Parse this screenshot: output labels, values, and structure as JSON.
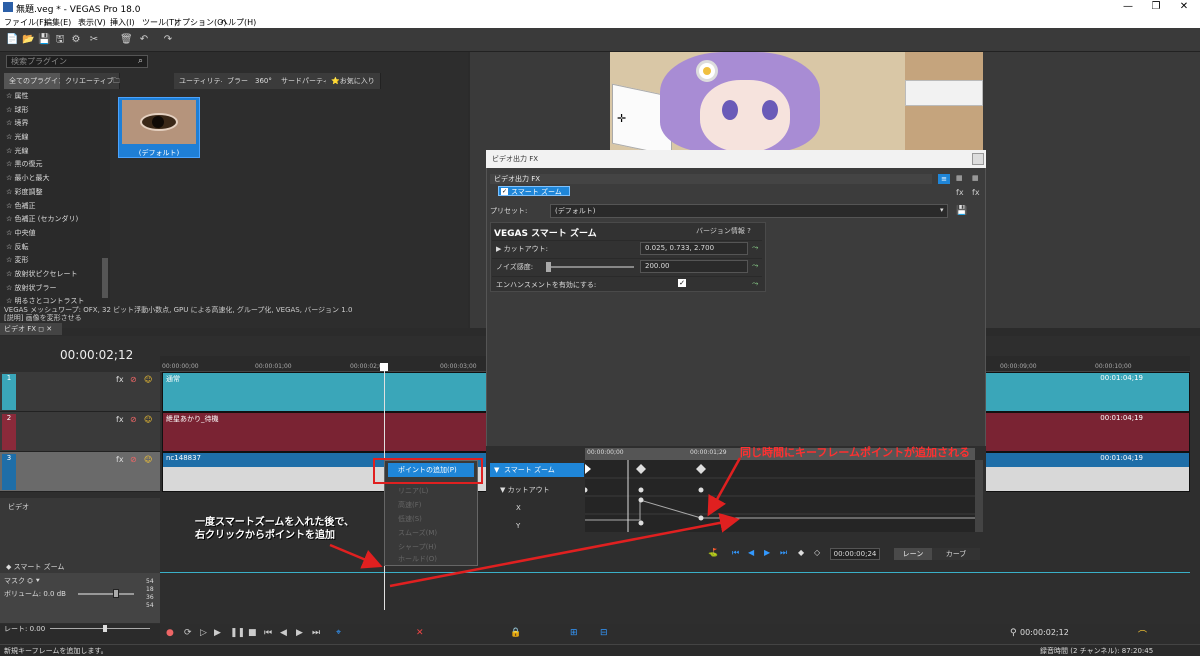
{
  "window": {
    "title": "無題.veg * - VEGAS Pro 18.0",
    "controls": [
      "—",
      "❐",
      "✕"
    ]
  },
  "menu": [
    "ファイル(F)",
    "編集(E)",
    "表示(V)",
    "挿入(I)",
    "ツール(T)",
    "オプション(O)",
    "ヘルプ(H)"
  ],
  "toolbar_icons": [
    "📄",
    "📂",
    "💾",
    "🖫",
    "⚙",
    "✂",
    "🗑",
    "↶",
    "↷"
  ],
  "plugins": {
    "search_placeholder": "検索プラグイン",
    "tabs": [
      "全てのプラグイン",
      "クリエーティブ",
      "🗀",
      "ユーティリティ",
      "ブラー",
      "360°",
      "サードパーティ",
      "⭐お気に入り"
    ],
    "list": [
      "☆ 属性",
      "☆ 球形",
      "☆ 境界",
      "☆ 光線",
      "☆ 光線",
      "☆ 黒の復元",
      "☆ 最小と最大",
      "☆ 彩度調整",
      "☆ 色補正",
      "☆ 色補正 (セカンダリ)",
      "☆ 中央値",
      "☆ 反転",
      "☆ 変形",
      "☆ 放射状ピクセレート",
      "☆ 放射状ブラー",
      "☆ 明るさとコントラスト"
    ],
    "preset_thumb_label": "(デフォルト)",
    "info_line1": "VEGAS メッシュワープ: OFX, 32 ビット浮動小数点, GPU による高速化, グループ化, VEGAS, バージョン 1.0",
    "info_line2": "[説明] 画像を変形させる",
    "fx_tab": "ビデオ FX ◻ ✕"
  },
  "timeline": {
    "timecode": "00:00:02;12",
    "ruler_ticks": [
      "00:00:00;00",
      "00:00:01;00",
      "00:00:02;00",
      "00:00:03;00",
      "00:00:09;00",
      "00:00:10;00"
    ],
    "tracks": [
      {
        "num": "1",
        "clip": "通常",
        "dur": "00:01:04;19"
      },
      {
        "num": "2",
        "clip": "紲星あかり_待機",
        "dur": "00:01:04;19"
      },
      {
        "num": "3",
        "clip": "nc148837",
        "dur": "00:01:04;19"
      }
    ],
    "video_label": "ビデオ",
    "smartzoom_label": "◆ スマート ズーム",
    "mask_label": "マスク ⛭ ⯆",
    "volume_label": "ボリューム:   0.0 dB",
    "meter": [
      "54",
      "18",
      "36",
      "54"
    ],
    "rate_label": "レート: 0.00",
    "current_time": "00:00:02;12"
  },
  "dialog": {
    "title": "ビデオ出力 FX",
    "header": "ビデオ出力 FX",
    "chain_item": "スマート ズーム",
    "preset_label": "プリセット:",
    "preset_value": "(デフォルト)",
    "fx_name": "VEGAS スマート ズーム",
    "version_info": "バージョン情報   ?",
    "params": [
      {
        "name": "▶  カットアウト:",
        "value": "0.025, 0.733, 2.700"
      },
      {
        "name": "ノイズ感度:",
        "value": "200.00"
      },
      {
        "name": "エンハンスメントを有効にする:",
        "value": ""
      }
    ],
    "kf_smart": "スマート ズーム",
    "kf_cutout": "▼ カットアウト",
    "kf_x": "X",
    "kf_y": "Y",
    "kf_ruler": [
      "00:00:00;00",
      "00:00:01;29"
    ],
    "kf_time": "00:00:00;24",
    "lane_btn": "レーン",
    "curve_btn": "カーブ"
  },
  "context_menu": [
    "ポイントの追加(P)",
    "リニア(L)",
    "高速(F)",
    "低速(S)",
    "スムーズ(M)",
    "シャープ(H)",
    "ホールド(O)"
  ],
  "annotations": {
    "top": "同じ時間にキーフレームポイントが追加される",
    "left_1": "一度スマートズームを入れた後で、",
    "left_2": "右クリックからポイントを追加"
  },
  "status": {
    "left": "新規キーフレームを追加します。",
    "right": "録音時間 (2 チャンネル): 87:20:45"
  },
  "colors": {
    "accent": "#1f86d8",
    "annotation": "#ff3030",
    "track1": "#3aa6b9",
    "track2": "#8a2a3a",
    "track3": "#1e6ea8"
  }
}
